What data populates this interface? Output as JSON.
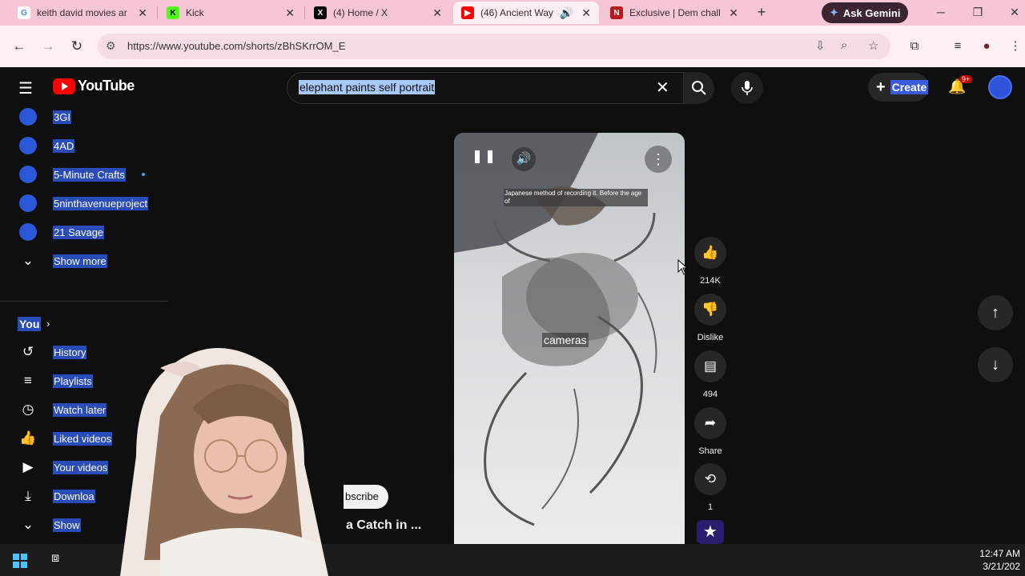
{
  "browser": {
    "tabs": [
      {
        "title": "keith david movies ar",
        "favicon": "google-icon"
      },
      {
        "title": "Kick",
        "favicon": "kick-icon"
      },
      {
        "title": "(4) Home / X",
        "favicon": "x-icon"
      },
      {
        "title": "(46) Ancient Way",
        "favicon": "youtube-icon",
        "active": true
      },
      {
        "title": "Exclusive | Dem chall",
        "favicon": "news-icon"
      }
    ],
    "ask_gemini": "Ask Gemini",
    "url": "https://www.youtube.com/shorts/zBhSKrrOM_E"
  },
  "youtube": {
    "logo_text": "YouTube",
    "search_query": "elephant paints self portrait",
    "create_label": "Create",
    "notification_badge": "9+"
  },
  "sidebar": {
    "subscriptions": [
      {
        "label": "3GI"
      },
      {
        "label": "4AD"
      },
      {
        "label": "5-Minute Crafts",
        "new": true
      },
      {
        "label": "5ninthavenueproject"
      },
      {
        "label": "21 Savage"
      }
    ],
    "show_more": "Show more",
    "you_heading": "You",
    "you_items": [
      {
        "label": "History",
        "icon": "history-icon"
      },
      {
        "label": "Playlists",
        "icon": "playlists-icon"
      },
      {
        "label": "Watch later",
        "icon": "clock-icon"
      },
      {
        "label": "Liked videos",
        "icon": "thumb-up-icon"
      },
      {
        "label": "Your videos",
        "icon": "video-icon"
      },
      {
        "label": "Downloa",
        "icon": "download-icon"
      },
      {
        "label": "Show",
        "icon": "chevron-down-icon"
      }
    ]
  },
  "short": {
    "small_caption": "Japanese method of recording it. Before the age of",
    "caption": "cameras",
    "likes": "214K",
    "dislike_label": "Dislike",
    "comments": "494",
    "share_label": "Share",
    "remix_count": "1",
    "subscribe_label": "bscribe",
    "title_fragment": "a Catch in ..."
  },
  "taskbar": {
    "time": "12:47 AM",
    "date": "3/21/202"
  }
}
